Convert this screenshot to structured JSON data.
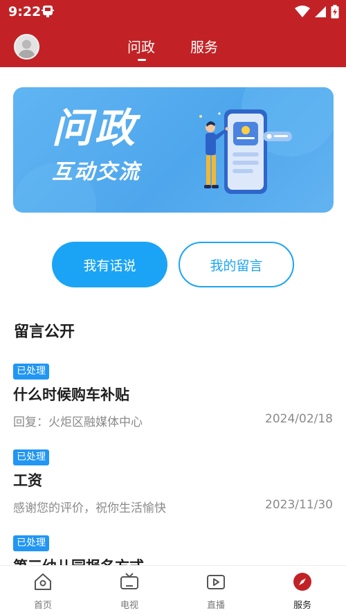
{
  "status_bar": {
    "time": "9:22",
    "app_icon": "bug-icon",
    "icons": [
      "wifi-icon",
      "signal-icon",
      "battery-charging-icon"
    ]
  },
  "header": {
    "avatar": "default-avatar",
    "tabs": [
      {
        "label": "问政",
        "active": true
      },
      {
        "label": "服务",
        "active": false
      }
    ],
    "bg_color": "#c22226"
  },
  "banner": {
    "title": "问政",
    "subtitle": "互动交流",
    "bg_color": "#56abee"
  },
  "actions": {
    "primary_label": "我有话说",
    "secondary_label": "我的留言",
    "accent_color": "#1ba4f5"
  },
  "section": {
    "title": "留言公开"
  },
  "messages": [
    {
      "status": "已处理",
      "title": "什么时候购车补贴",
      "reply": "回复：火炬区融媒体中心",
      "date": "2024/02/18"
    },
    {
      "status": "已处理",
      "title": "工资",
      "reply": "感谢您的评价，祝你生活愉快",
      "date": "2023/11/30"
    },
    {
      "status": "已处理",
      "title": "第三幼儿园报名方式",
      "reply": "",
      "date": ""
    }
  ],
  "bottom_nav": {
    "items": [
      {
        "label": "首页",
        "icon": "home-icon",
        "active": false
      },
      {
        "label": "电视",
        "icon": "tv-icon",
        "active": false
      },
      {
        "label": "直播",
        "icon": "live-video-icon",
        "active": false
      },
      {
        "label": "服务",
        "icon": "compass-icon",
        "active": true
      }
    ],
    "active_color": "#c22226"
  }
}
